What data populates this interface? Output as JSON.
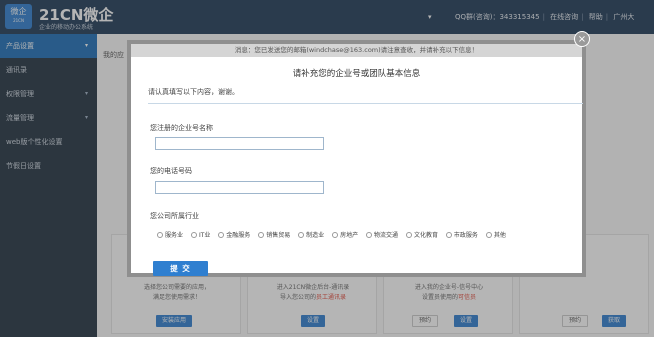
{
  "header": {
    "logo_main": "微企",
    "logo_small": "21CN",
    "brand_title": "21CN微企",
    "brand_subtitle": "企业的移动办公系统",
    "user_dropdown": "▾",
    "links": [
      "QQ群(咨询)：343315345",
      "在线咨询",
      "帮助",
      "广州大"
    ]
  },
  "sidebar": {
    "items": [
      {
        "label": "产品设置",
        "arrow": "▾",
        "active": true
      },
      {
        "label": "通讯录",
        "arrow": ""
      },
      {
        "label": "权限管理",
        "arrow": "▾"
      },
      {
        "label": "流量管理",
        "arrow": "▾"
      },
      {
        "label": "web版个性化设置",
        "arrow": ""
      },
      {
        "label": "节假日设置",
        "arrow": ""
      }
    ]
  },
  "main": {
    "title": "我的应",
    "cards": [
      {
        "desc1": "选择您公司需要的应用，",
        "desc2": "满足您使用需求！",
        "highlight": "",
        "button": "安装应用"
      },
      {
        "desc1": "进入21CN微企后台-通讯录",
        "desc2": "导入您公司的",
        "highlight": "员工通讯录",
        "button": "设置"
      },
      {
        "desc1": "进入我的企业号-信号中心",
        "desc2": "设置员使用的",
        "highlight": "可信员",
        "button": "设置",
        "button2": "预约"
      },
      {
        "desc1": "",
        "desc2": "",
        "highlight": "",
        "button": "预约",
        "button2": "获取"
      }
    ]
  },
  "modal": {
    "notice": "消息：您已发送您的邮箱(windchase@163.com)请注意查收，并请补充以下信息！",
    "close": "×",
    "title": "请补充您的企业号或团队基本信息",
    "subtitle": "请认真填写以下内容，谢谢。",
    "field1_label": "您注册的企业号名称",
    "field1_value": "",
    "field2_label": "您的电话号码",
    "field2_value": "",
    "industry_label": "您公司所属行业",
    "industries": [
      "服务业",
      "IT业",
      "金融服务",
      "销售贸易",
      "制造业",
      "房地产",
      "物流交通",
      "文化教育",
      "市政服务",
      "其他"
    ],
    "submit": "提 交"
  }
}
